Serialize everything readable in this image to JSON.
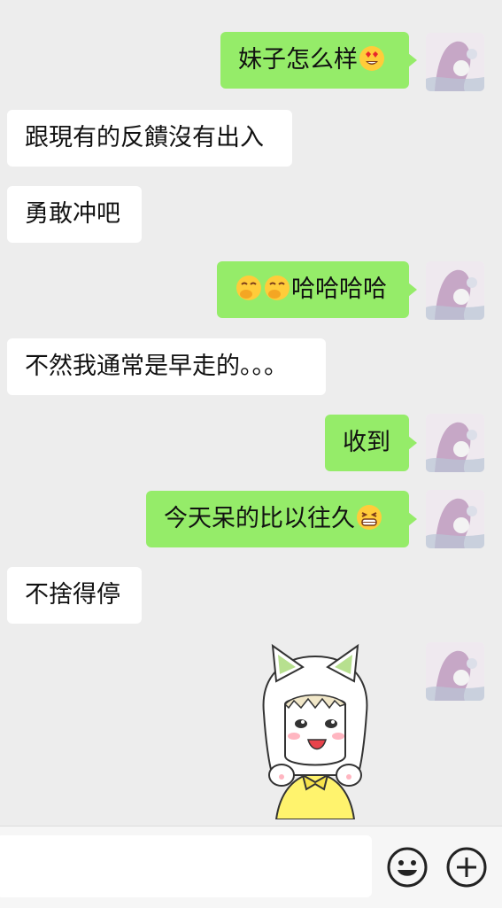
{
  "messages": [
    {
      "side": "out",
      "parts": [
        "妹子怎么样"
      ],
      "emoji": [
        "heart-eyes"
      ]
    },
    {
      "side": "in",
      "text": "跟現有的反饋沒有出入"
    },
    {
      "side": "in",
      "text": "勇敢冲吧"
    },
    {
      "side": "out",
      "text": "哈哈哈哈",
      "emoji": [
        "covering-mouth",
        "covering-mouth"
      ]
    },
    {
      "side": "in",
      "text": "不然我通常是早走的。。。"
    },
    {
      "side": "out",
      "text": "收到"
    },
    {
      "side": "out",
      "text": "今天呆的比以往久",
      "emoji": [
        "grimacing"
      ]
    },
    {
      "side": "in",
      "text": "不捨得停"
    },
    {
      "side": "out",
      "sticker": "cat-girl-sticker"
    }
  ],
  "input": {
    "value": "",
    "placeholder": ""
  },
  "colors": {
    "background": "#ededed",
    "outgoing_bubble": "#95ec69",
    "incoming_bubble": "#ffffff"
  },
  "icons": [
    "emoji-icon",
    "plus-icon",
    "user-avatar"
  ]
}
